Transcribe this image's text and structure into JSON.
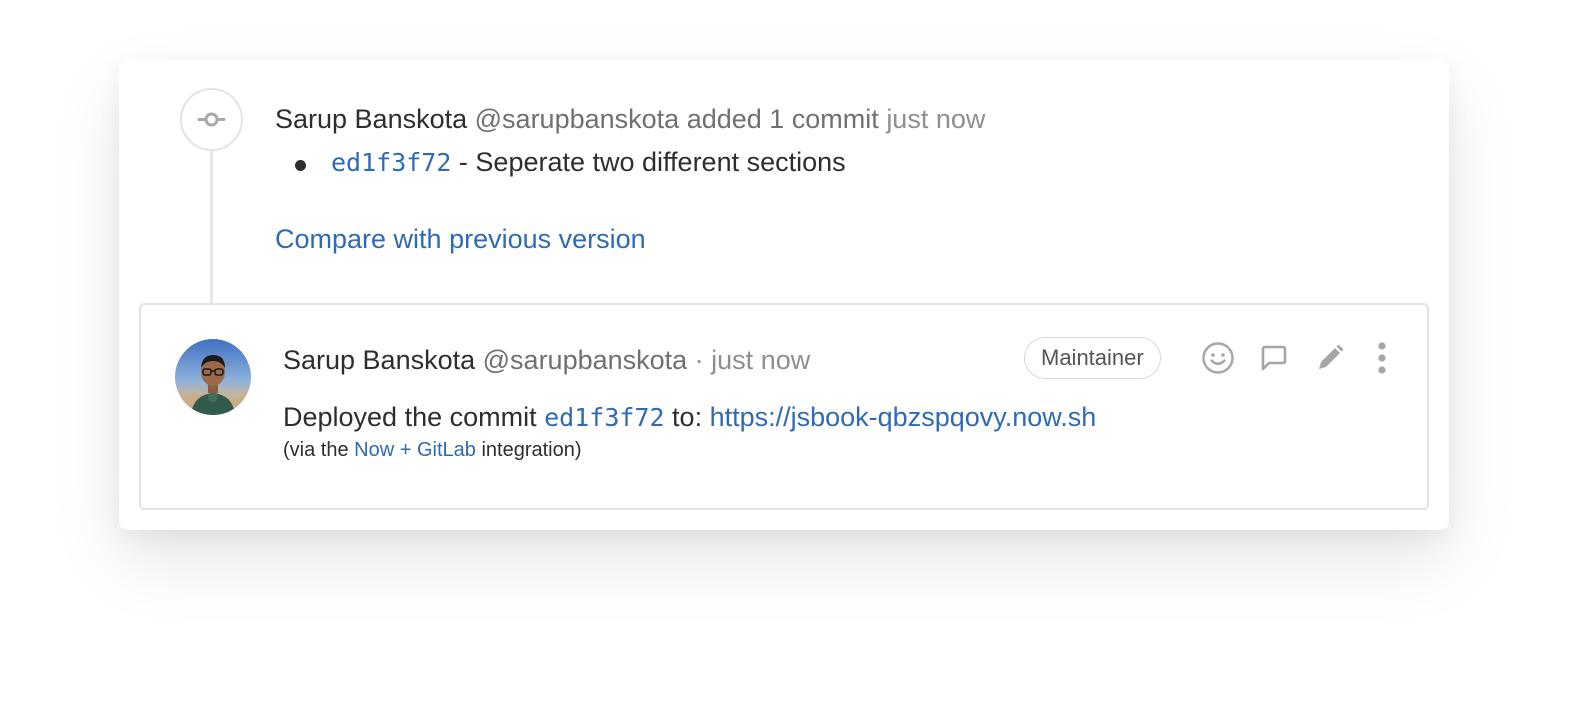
{
  "system_note": {
    "author_name": "Sarup Banskota",
    "author_handle": "@sarupbanskota",
    "action": "added 1 commit",
    "time": "just now",
    "commit": {
      "sha": "ed1f3f72",
      "separator": " - ",
      "message": "Seperate two different sections"
    },
    "compare_link": "Compare with previous version",
    "icon": "commit-icon"
  },
  "note": {
    "author_name": "Sarup Banskota",
    "author_handle": "@sarupbanskota",
    "dot": " · ",
    "time": "just now",
    "role_badge": "Maintainer",
    "body": {
      "prefix": "Deployed the commit ",
      "sha": "ed1f3f72",
      "middle": " to: ",
      "url": "https://jsbook-qbzspqovy.now.sh"
    },
    "sub": {
      "prefix": "(via the ",
      "link": "Now + GitLab",
      "suffix": " integration)"
    },
    "actions": [
      {
        "name": "award-emoji-button",
        "icon": "smiley-icon"
      },
      {
        "name": "reply-button",
        "icon": "comment-icon"
      },
      {
        "name": "edit-button",
        "icon": "pencil-icon"
      },
      {
        "name": "more-actions-button",
        "icon": "ellipsis-vertical-icon"
      }
    ]
  },
  "colors": {
    "link": "#2f6ab5",
    "text": "#2e2e2e",
    "muted": "#707070",
    "border": "#e3e3e3"
  }
}
